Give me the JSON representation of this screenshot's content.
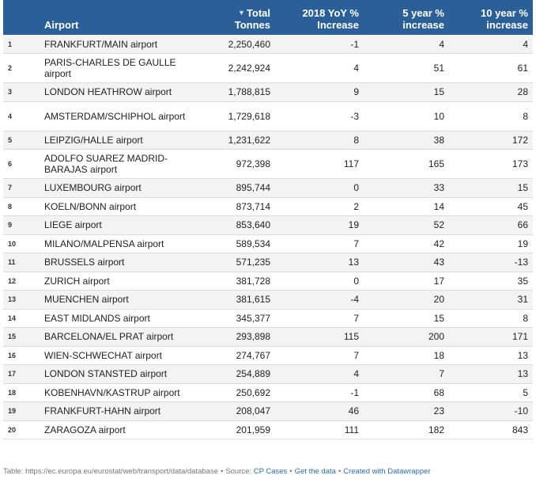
{
  "header": {
    "airport": "Airport",
    "total_line1": "Total",
    "total_line2": "Tonnes",
    "sort_icon": "triangle-down",
    "yoy_line1": "2018 YoY %",
    "yoy_line2": "Increase",
    "five_line1": "5 year %",
    "five_line2": "increase",
    "ten_line1": "10 year %",
    "ten_line2": "increase"
  },
  "rows": [
    {
      "rank": "1",
      "airport": "FRANKFURT/MAIN airport",
      "total": "2,250,460",
      "yoy": "-1",
      "five": "4",
      "ten": "4"
    },
    {
      "rank": "2",
      "airport": "PARIS-CHARLES DE GAULLE airport",
      "total": "2,242,924",
      "yoy": "4",
      "five": "51",
      "ten": "61"
    },
    {
      "rank": "3",
      "airport": "LONDON HEATHROW airport",
      "total": "1,788,815",
      "yoy": "9",
      "five": "15",
      "ten": "28"
    },
    {
      "rank": "4",
      "airport": "AMSTERDAM/SCHIPHOL airport",
      "total": "1,729,618",
      "yoy": "-3",
      "five": "10",
      "ten": "8"
    },
    {
      "rank": "5",
      "airport": "LEIPZIG/HALLE airport",
      "total": "1,231,622",
      "yoy": "8",
      "five": "38",
      "ten": "172"
    },
    {
      "rank": "6",
      "airport": "ADOLFO SUAREZ MADRID-BARAJAS airport",
      "total": "972,398",
      "yoy": "117",
      "five": "165",
      "ten": "173"
    },
    {
      "rank": "7",
      "airport": "LUXEMBOURG airport",
      "total": "895,744",
      "yoy": "0",
      "five": "33",
      "ten": "15"
    },
    {
      "rank": "8",
      "airport": "KOELN/BONN airport",
      "total": "873,714",
      "yoy": "2",
      "five": "14",
      "ten": "45"
    },
    {
      "rank": "9",
      "airport": "LIEGE airport",
      "total": "853,640",
      "yoy": "19",
      "five": "52",
      "ten": "66"
    },
    {
      "rank": "10",
      "airport": "MILANO/MALPENSA airport",
      "total": "589,534",
      "yoy": "7",
      "five": "42",
      "ten": "19"
    },
    {
      "rank": "11",
      "airport": "BRUSSELS airport",
      "total": "571,235",
      "yoy": "13",
      "five": "43",
      "ten": "-13"
    },
    {
      "rank": "12",
      "airport": "ZURICH airport",
      "total": "381,728",
      "yoy": "0",
      "five": "17",
      "ten": "35"
    },
    {
      "rank": "13",
      "airport": "MUENCHEN airport",
      "total": "381,615",
      "yoy": "-4",
      "five": "20",
      "ten": "31"
    },
    {
      "rank": "14",
      "airport": "EAST MIDLANDS airport",
      "total": "345,377",
      "yoy": "7",
      "five": "15",
      "ten": "8"
    },
    {
      "rank": "15",
      "airport": "BARCELONA/EL PRAT airport",
      "total": "293,898",
      "yoy": "115",
      "five": "200",
      "ten": "171"
    },
    {
      "rank": "16",
      "airport": "WIEN-SCHWECHAT airport",
      "total": "274,767",
      "yoy": "7",
      "five": "18",
      "ten": "13"
    },
    {
      "rank": "17",
      "airport": "LONDON STANSTED airport",
      "total": "254,889",
      "yoy": "4",
      "five": "7",
      "ten": "13"
    },
    {
      "rank": "18",
      "airport": "KOBENHAVN/KASTRUP airport",
      "total": "250,692",
      "yoy": "-1",
      "five": "68",
      "ten": "5"
    },
    {
      "rank": "19",
      "airport": "FRANKFURT-HAHN airport",
      "total": "208,047",
      "yoy": "46",
      "five": "23",
      "ten": "-10"
    },
    {
      "rank": "20",
      "airport": "ZARAGOZA airport",
      "total": "201,959",
      "yoy": "111",
      "five": "182",
      "ten": "843"
    }
  ],
  "footer": {
    "prefix": "Table: https://ec.europa.eu/eurostat/web/transport/data/database",
    "separator": "•",
    "source_label": "Source:",
    "source_link": "CP Cases",
    "get_data": "Get the data",
    "created_with": "Created with Datawrapper"
  },
  "colors": {
    "header_bg": "#2a5f97",
    "link": "#2a6fb0"
  }
}
